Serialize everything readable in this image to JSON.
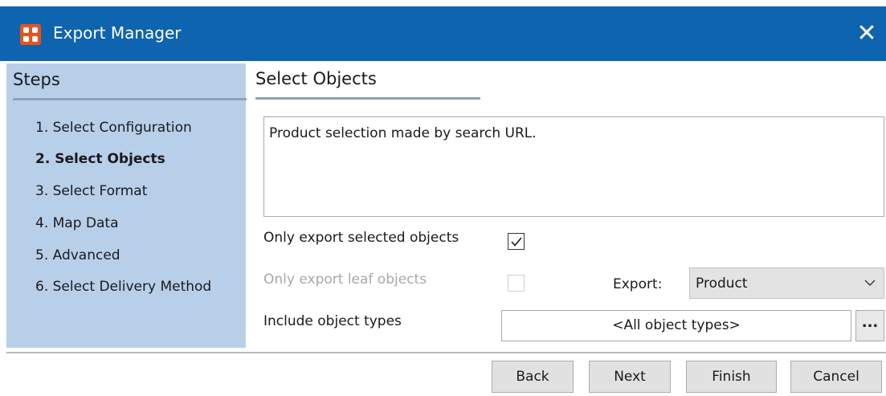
{
  "window": {
    "title": "Export Manager",
    "close_glyph": "✕",
    "app_icon": "export-manager-logo",
    "accent_color": "#0f64b0"
  },
  "sidebar": {
    "heading": "Steps",
    "background_color": "#b8cfea",
    "steps": [
      {
        "label": "1. Select Configuration",
        "active": false
      },
      {
        "label": "2. Select Objects",
        "active": true
      },
      {
        "label": "3. Select Format",
        "active": false
      },
      {
        "label": "4. Map Data",
        "active": false
      },
      {
        "label": "5. Advanced",
        "active": false
      },
      {
        "label": "6. Select Delivery Method",
        "active": false
      }
    ]
  },
  "panel": {
    "title": "Select Objects",
    "description": "Product selection made by search URL.",
    "only_selected": {
      "label": "Only export selected objects",
      "checked": true,
      "enabled": true
    },
    "only_leaf": {
      "label": "Only export leaf objects",
      "checked": false,
      "enabled": false
    },
    "export": {
      "label": "Export:",
      "value": "Product"
    },
    "include_types": {
      "label": "Include object types",
      "value": "<All object types>",
      "browse_label": "..."
    }
  },
  "footer": {
    "back_label": "Back",
    "next_label": "Next",
    "finish_label": "Finish",
    "cancel_label": "Cancel"
  }
}
